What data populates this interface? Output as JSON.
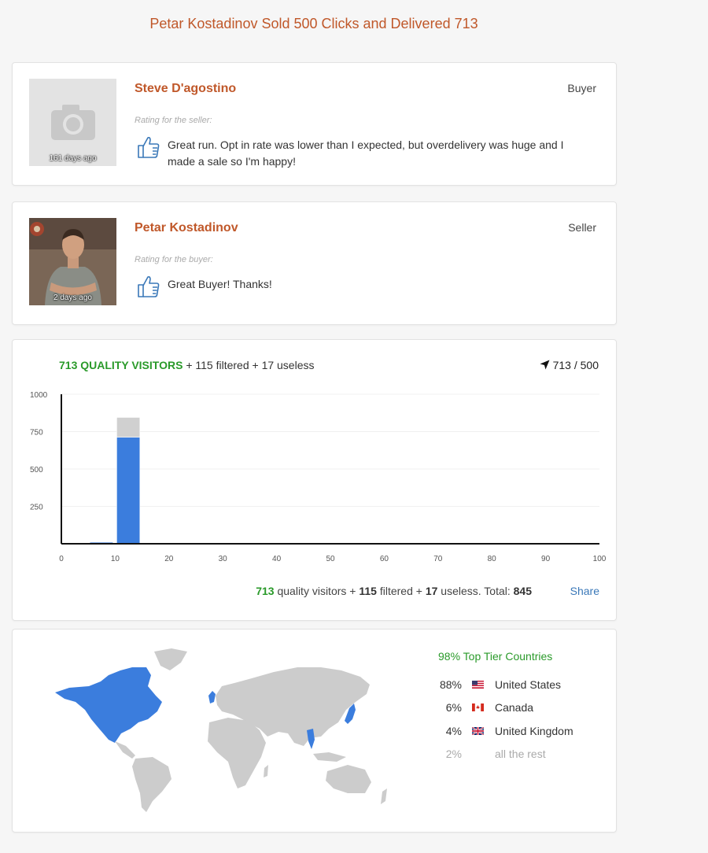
{
  "page": {
    "title": "Petar Kostadinov Sold 500 Clicks and Delivered 713"
  },
  "reviews": [
    {
      "name": "Steve D'agostino",
      "role": "Buyer",
      "days_ago": "161 days ago",
      "rating_label": "Rating for the seller:",
      "comment": "Great run. Opt in rate was lower than I expected, but overdelivery was huge and I made a sale so I'm happy!",
      "avatar": "camera-placeholder-icon"
    },
    {
      "name": "Petar Kostadinov",
      "role": "Seller",
      "days_ago": "2 days ago",
      "rating_label": "Rating for the buyer:",
      "comment": "Great Buyer! Thanks!",
      "avatar": "profile-photo"
    }
  ],
  "stats": {
    "quality_label": "713 QUALITY VISITORS",
    "header_rest": "+ 115 filtered + 17 useless",
    "delivered_ratio": "713 / 500",
    "quality": "713",
    "filtered": "115",
    "useless": "17",
    "total": "845",
    "text_quality": "quality visitors +",
    "text_filtered": "filtered +",
    "text_useless": "useless. Total:",
    "share_label": "Share"
  },
  "chart_data": {
    "type": "bar",
    "stacked": true,
    "x": [
      5,
      10
    ],
    "series": [
      {
        "name": "",
        "color": "#3b7ddd",
        "values": [
          10,
          713
        ]
      },
      {
        "name": "",
        "color": "#d0d0d0",
        "values": [
          0,
          132
        ]
      }
    ],
    "xlim": [
      0,
      100
    ],
    "ylim": [
      0,
      1000
    ],
    "x_ticks": [
      "0",
      "10",
      "20",
      "30",
      "40",
      "50",
      "60",
      "70",
      "80",
      "90",
      "100"
    ],
    "y_ticks": [
      "1000",
      "750",
      "500",
      "250"
    ],
    "grid": true
  },
  "geo": {
    "top_tier_label": "98% Top Tier Countries",
    "countries": [
      {
        "pct": "88%",
        "name": "United States",
        "flag": "us-flag-icon"
      },
      {
        "pct": "6%",
        "name": "Canada",
        "flag": "ca-flag-icon"
      },
      {
        "pct": "4%",
        "name": "United Kingdom",
        "flag": "uk-flag-icon"
      },
      {
        "pct": "2%",
        "name": "all the rest",
        "flag": ""
      }
    ],
    "highlight_color": "#3b7ddd",
    "land_color": "#cccccc"
  }
}
